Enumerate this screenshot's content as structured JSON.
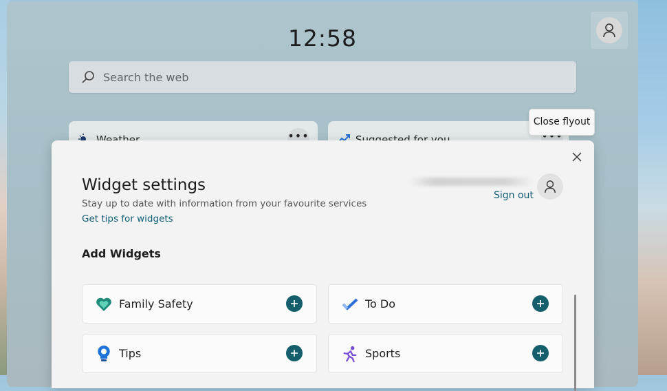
{
  "board": {
    "time": "12:58",
    "search_placeholder": "Search the web",
    "cards": [
      {
        "title": "Weather"
      },
      {
        "title": "Suggested for you"
      }
    ]
  },
  "tooltip": "Close flyout",
  "settings": {
    "title": "Widget settings",
    "subtitle": "Stay up to date with information from your favourite services",
    "tips_link": "Get tips for widgets",
    "sign_out": "Sign out",
    "section_title": "Add Widgets",
    "widgets": [
      {
        "label": "Family Safety",
        "icon": "family-safety-icon"
      },
      {
        "label": "To Do",
        "icon": "todo-icon"
      },
      {
        "label": "Tips",
        "icon": "tips-icon"
      },
      {
        "label": "Sports",
        "icon": "sports-icon"
      }
    ]
  },
  "colors": {
    "accent": "#155f6c",
    "link": "#0f5e74"
  }
}
